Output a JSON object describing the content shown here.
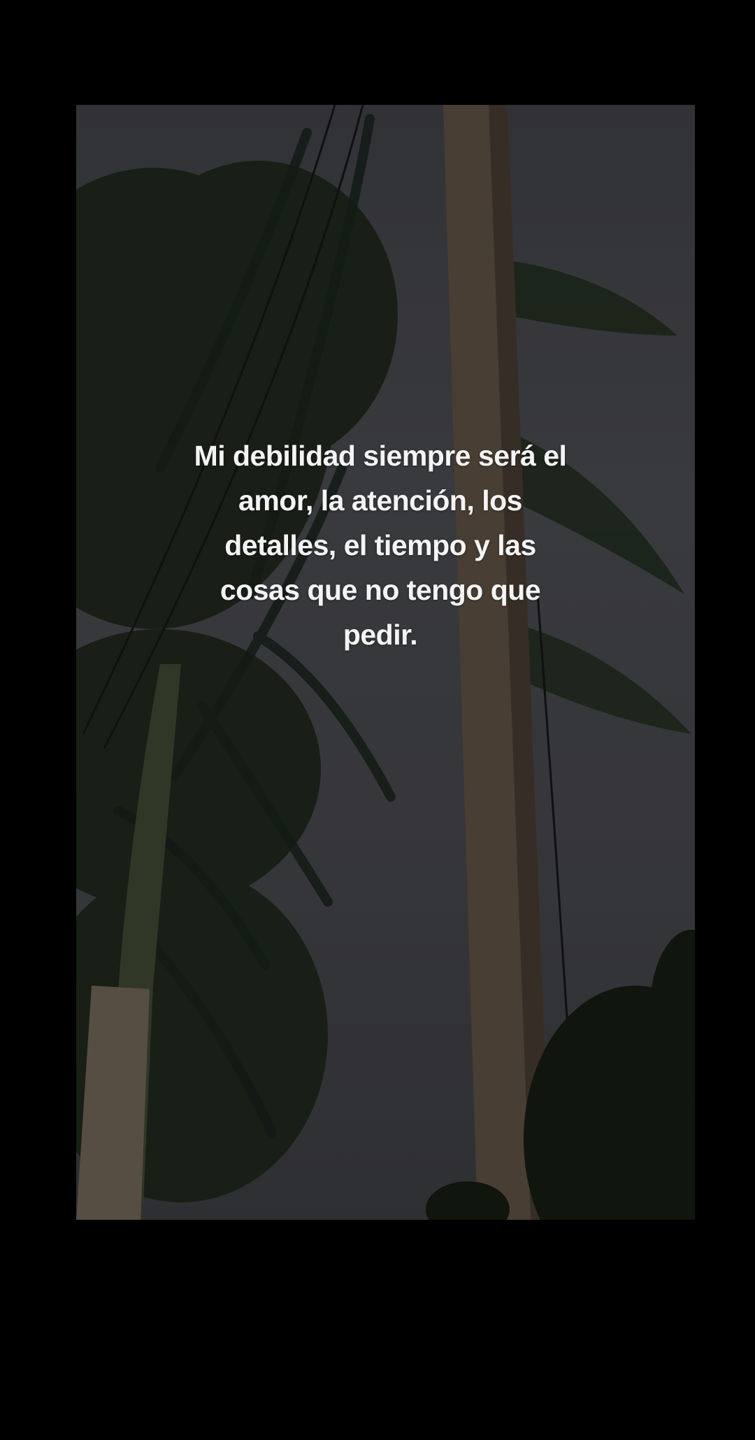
{
  "video": {
    "overlay_text": "Mi debilidad siempre será el amor, la atención, los detalles, el tiempo y las cosas que no tengo que pedir."
  },
  "colors": {
    "background": "#000000",
    "sky": "#434449",
    "foliage": "#1e2a1d",
    "pole": "#564a3c",
    "text": "#f4f4f4"
  }
}
